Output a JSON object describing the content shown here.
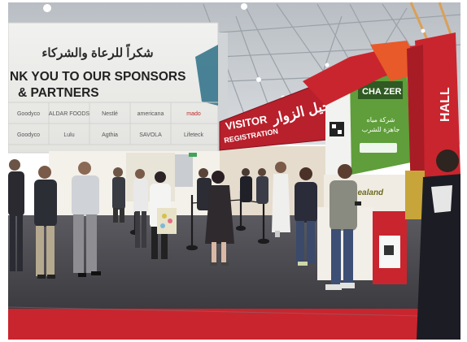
{
  "sponsor_board": {
    "arabic_heading": "شكراً للرعاة والشركاء",
    "english_line1": "NK YOU TO OUR SPONSORS",
    "english_line2": "& PARTNERS",
    "logos": [
      "Goodyco",
      "ALDAR FOODS",
      "Nestlé",
      "americana",
      "mado",
      "Goodyco",
      "Lulu",
      "Agthia",
      "SAVOLA",
      "Lifeteck"
    ]
  },
  "registration_sign": {
    "english_line1": "VISITOR",
    "english_line2": "REGISTRATION",
    "arabic": "تسجيل الزوار"
  },
  "hall_sign": {
    "label": "HALL"
  },
  "chazer_booth": {
    "brand": "CHA ZER",
    "arabic_lines": [
      "شركة مياه",
      "جاهزة للشرب"
    ]
  },
  "sealand_booth": {
    "brand": "Sealand"
  },
  "colors": {
    "floor": "#4a4a4f",
    "red_carpet": "#c9252e",
    "sign_red": "#b8202c",
    "booth_green": "#5f9e3a",
    "ceiling": "#c7ccd1"
  }
}
